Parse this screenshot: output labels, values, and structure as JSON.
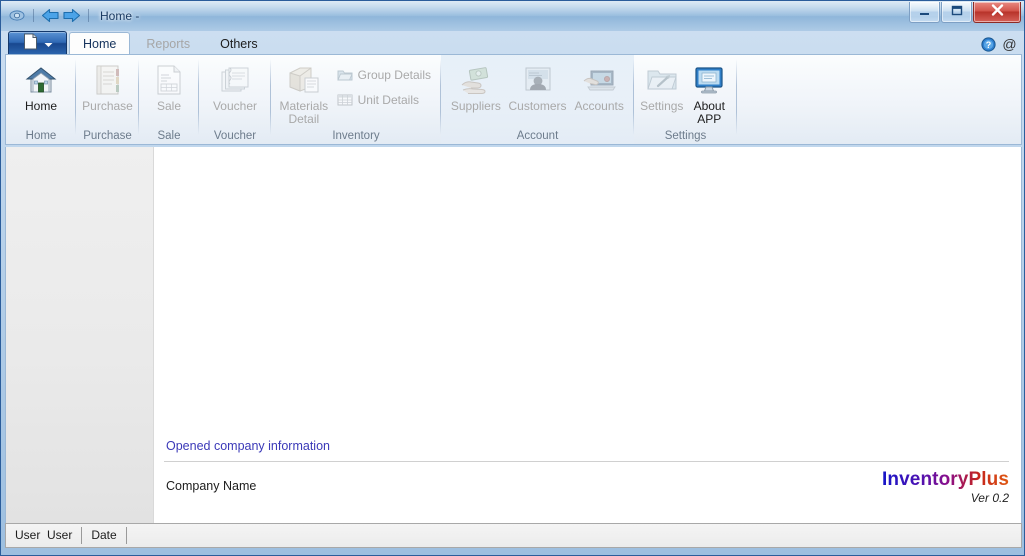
{
  "window": {
    "title": "Home -",
    "app_icon": "app-glass-icon",
    "nav": {
      "back": "back-arrow-icon",
      "forward": "forward-arrow-icon"
    },
    "controls": {
      "minimize": "minimize-icon",
      "maximize": "maximize-icon",
      "close": "close-icon"
    }
  },
  "ribbon": {
    "app_button": {
      "name": "application-menu-button",
      "icon": "document-icon",
      "arrow": "chevron-down-icon"
    },
    "tabs": [
      {
        "label": "Home",
        "state": "active"
      },
      {
        "label": "Reports",
        "state": "disabled"
      },
      {
        "label": "Others",
        "state": "enabled"
      }
    ],
    "help_icons": [
      {
        "name": "help-icon",
        "glyph": "?"
      },
      {
        "name": "at-icon",
        "glyph": "@"
      }
    ],
    "groups": [
      {
        "label": "Home",
        "tinted": false,
        "big_buttons": [
          {
            "label": "Home",
            "icon": "house-icon",
            "enabled": true
          }
        ],
        "small_buttons": []
      },
      {
        "label": "Purchase",
        "tinted": false,
        "big_buttons": [
          {
            "label": "Purchase",
            "icon": "notebook-icon",
            "enabled": false
          }
        ],
        "small_buttons": []
      },
      {
        "label": "Sale",
        "tinted": false,
        "big_buttons": [
          {
            "label": "Sale",
            "icon": "invoice-icon",
            "enabled": false
          }
        ],
        "small_buttons": []
      },
      {
        "label": "Voucher",
        "tinted": false,
        "big_buttons": [
          {
            "label": "Voucher",
            "icon": "vouchers-stack-icon",
            "enabled": false
          }
        ],
        "small_buttons": []
      },
      {
        "label": "Inventory",
        "tinted": false,
        "big_buttons": [
          {
            "label": "Materials Detail",
            "icon": "materials-box-icon",
            "enabled": false
          }
        ],
        "small_buttons": [
          {
            "label": "Group Details",
            "icon": "folder-icon",
            "enabled": false
          },
          {
            "label": "Unit Details",
            "icon": "grid-icon",
            "enabled": false
          }
        ]
      },
      {
        "label": "Account",
        "tinted": true,
        "big_buttons": [
          {
            "label": "Suppliers",
            "icon": "cash-hand-icon",
            "enabled": false
          },
          {
            "label": "Customers",
            "icon": "person-card-icon",
            "enabled": false
          },
          {
            "label": "Accounts",
            "icon": "accounts-laptop-icon",
            "enabled": false
          }
        ],
        "small_buttons": []
      },
      {
        "label": "Settings",
        "tinted": false,
        "big_buttons": [
          {
            "label": "Settings",
            "icon": "tools-folder-icon",
            "enabled": false
          },
          {
            "label": "About APP",
            "icon": "monitor-icon",
            "enabled": true
          }
        ],
        "small_buttons": []
      }
    ]
  },
  "content": {
    "section_heading": "Opened company information",
    "company_label": "Company Name",
    "brand_name": "InventoryPlus",
    "brand_version": "Ver 0.2"
  },
  "statusbar": {
    "cells": [
      "User  User",
      "Date"
    ]
  },
  "colors": {
    "accent_blue": "#2f68b4",
    "heading_purple": "#3b39b8",
    "close_red": "#b8332a",
    "disabled_gray": "#a9a9a9"
  }
}
